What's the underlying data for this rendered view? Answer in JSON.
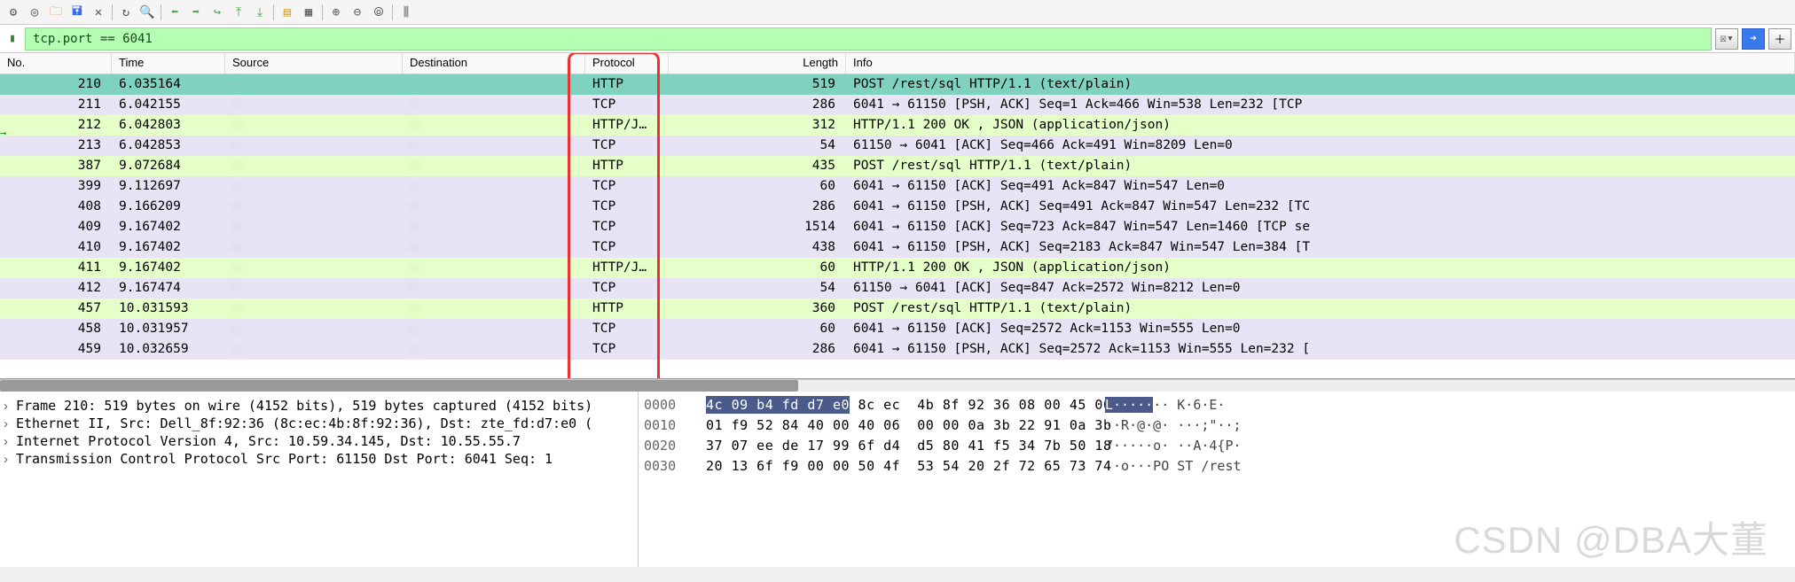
{
  "filter": {
    "value": "tcp.port == 6041"
  },
  "columns": {
    "no": "No.",
    "time": "Time",
    "src": "Source",
    "dst": "Destination",
    "proto": "Protocol",
    "len": "Length",
    "info": "Info"
  },
  "packets": [
    {
      "no": "210",
      "time": "6.035164",
      "src": "—",
      "dst": "—",
      "proto": "HTTP",
      "len": "519",
      "info": "POST /rest/sql HTTP/1.1  (text/plain)",
      "cls": "selected"
    },
    {
      "no": "211",
      "time": "6.042155",
      "src": "—",
      "dst": "—",
      "proto": "TCP",
      "len": "286",
      "info": "6041 → 61150 [PSH, ACK] Seq=1 Ack=466 Win=538 Len=232 [TCP",
      "cls": "purple"
    },
    {
      "no": "212",
      "time": "6.042803",
      "src": "—",
      "dst": "—",
      "proto": "HTTP/J…",
      "len": "312",
      "info": "HTTP/1.1 200 OK , JSON (application/json)",
      "cls": "green"
    },
    {
      "no": "213",
      "time": "6.042853",
      "src": "—",
      "dst": "—",
      "proto": "TCP",
      "len": "54",
      "info": "61150 → 6041 [ACK] Seq=466 Ack=491 Win=8209 Len=0",
      "cls": "purple"
    },
    {
      "no": "387",
      "time": "9.072684",
      "src": "—",
      "dst": "—",
      "proto": "HTTP",
      "len": "435",
      "info": "POST /rest/sql HTTP/1.1  (text/plain)",
      "cls": "green"
    },
    {
      "no": "399",
      "time": "9.112697",
      "src": "—",
      "dst": "—",
      "proto": "TCP",
      "len": "60",
      "info": "6041 → 61150 [ACK] Seq=491 Ack=847 Win=547 Len=0",
      "cls": "purple"
    },
    {
      "no": "408",
      "time": "9.166209",
      "src": "—",
      "dst": "—",
      "proto": "TCP",
      "len": "286",
      "info": "6041 → 61150 [PSH, ACK] Seq=491 Ack=847 Win=547 Len=232 [TC",
      "cls": "purple"
    },
    {
      "no": "409",
      "time": "9.167402",
      "src": "—",
      "dst": "—",
      "proto": "TCP",
      "len": "1514",
      "info": "6041 → 61150 [ACK] Seq=723 Ack=847 Win=547 Len=1460 [TCP se",
      "cls": "purple"
    },
    {
      "no": "410",
      "time": "9.167402",
      "src": "—",
      "dst": "—",
      "proto": "TCP",
      "len": "438",
      "info": "6041 → 61150 [PSH, ACK] Seq=2183 Ack=847 Win=547 Len=384 [T",
      "cls": "purple"
    },
    {
      "no": "411",
      "time": "9.167402",
      "src": "—",
      "dst": "—",
      "proto": "HTTP/J…",
      "len": "60",
      "info": "HTTP/1.1 200 OK , JSON (application/json)",
      "cls": "green"
    },
    {
      "no": "412",
      "time": "9.167474",
      "src": "—",
      "dst": "—",
      "proto": "TCP",
      "len": "54",
      "info": "61150 → 6041 [ACK] Seq=847 Ack=2572 Win=8212 Len=0",
      "cls": "purple"
    },
    {
      "no": "457",
      "time": "10.031593",
      "src": "—",
      "dst": "—",
      "proto": "HTTP",
      "len": "360",
      "info": "POST /rest/sql HTTP/1.1  (text/plain)",
      "cls": "green"
    },
    {
      "no": "458",
      "time": "10.031957",
      "src": "—",
      "dst": "—",
      "proto": "TCP",
      "len": "60",
      "info": "6041 → 61150 [ACK] Seq=2572 Ack=1153 Win=555 Len=0",
      "cls": "purple"
    },
    {
      "no": "459",
      "time": "10.032659",
      "src": "—",
      "dst": "—",
      "proto": "TCP",
      "len": "286",
      "info": "6041 → 61150 [PSH, ACK] Seq=2572 Ack=1153 Win=555 Len=232 [",
      "cls": "purple"
    }
  ],
  "tree": {
    "frame": "Frame 210: 519 bytes on wire (4152 bits), 519 bytes captured (4152 bits)",
    "eth": "Ethernet II, Src: Dell_8f:92:36 (8c:ec:4b:8f:92:36), Dst: zte_fd:d7:e0 (",
    "ip": "Internet Protocol Version 4, Src: 10.59.34.145, Dst: 10.55.55.7",
    "tcp": "Transmission Control Protocol  Src Port: 61150  Dst Port: 6041  Seq: 1"
  },
  "hex": [
    {
      "off": "0000",
      "b1hl": "4c 09 b4 fd d7 e0",
      "b1": " 8c ec",
      "b2": "4b 8f 92 36 08 00 45 00",
      "a1hl": "L·····",
      "a1": "·· K·6·E·"
    },
    {
      "off": "0010",
      "b1": "01 f9 52 84 40 00 40 06",
      "b2": "00 00 0a 3b 22 91 0a 3b",
      "a1": "··R·@·@· ···;\"··;"
    },
    {
      "off": "0020",
      "b1": "37 07 ee de 17 99 6f d4",
      "b2": "d5 80 41 f5 34 7b 50 18",
      "a1": "7·····o· ··A·4{P·"
    },
    {
      "off": "0030",
      "b1": "20 13 6f f9 00 00 50 4f",
      "b2": "53 54 20 2f 72 65 73 74",
      "a1": " ·o···PO ST /rest"
    }
  ],
  "watermark": "CSDN @DBA大董"
}
